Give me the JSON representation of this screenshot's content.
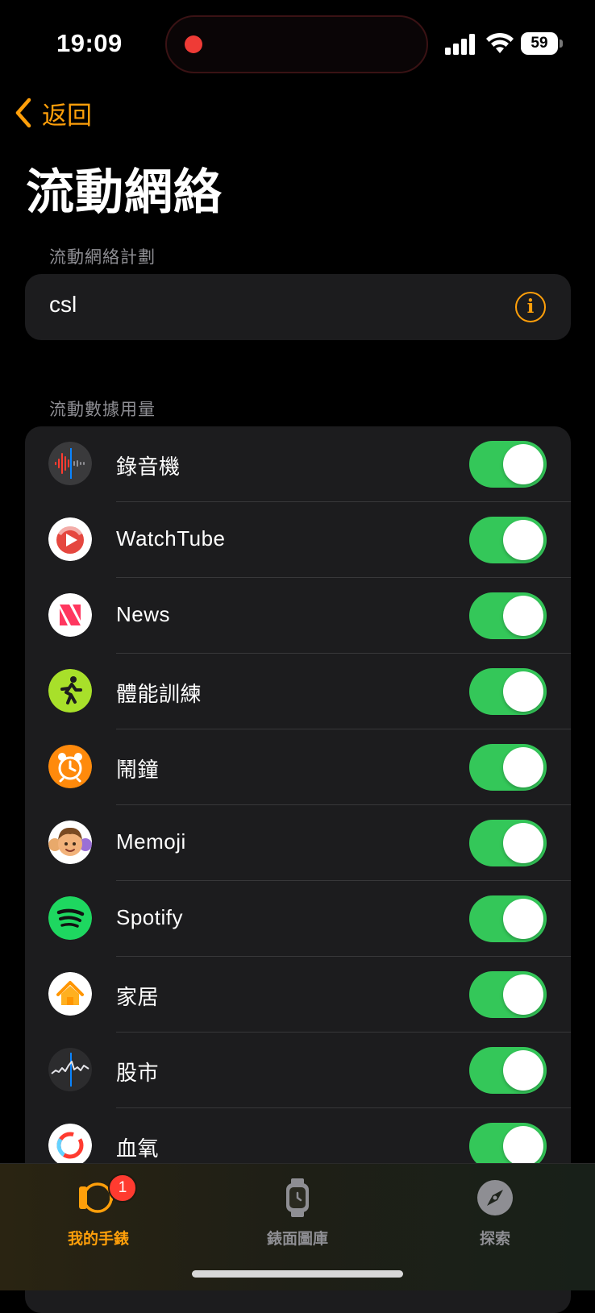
{
  "status_bar": {
    "time": "19:09",
    "battery": "59",
    "recording_color": "#ef3b36"
  },
  "nav": {
    "back_label": "返回"
  },
  "page": {
    "title": "流動網絡"
  },
  "plan_section": {
    "header": "流動網絡計劃",
    "plan_name": "csl"
  },
  "usage_section": {
    "header": "流動數據用量",
    "apps": [
      {
        "name": "錄音機",
        "icon": "voice-memos-icon",
        "enabled": true
      },
      {
        "name": "WatchTube",
        "icon": "watchtube-icon",
        "enabled": true
      },
      {
        "name": "News",
        "icon": "news-icon",
        "enabled": true
      },
      {
        "name": "體能訓練",
        "icon": "workout-icon",
        "enabled": true
      },
      {
        "name": "鬧鐘",
        "icon": "alarm-icon",
        "enabled": true
      },
      {
        "name": "Memoji",
        "icon": "memoji-icon",
        "enabled": true
      },
      {
        "name": "Spotify",
        "icon": "spotify-icon",
        "enabled": true
      },
      {
        "name": "家居",
        "icon": "home-icon",
        "enabled": true
      },
      {
        "name": "股市",
        "icon": "stocks-icon",
        "enabled": true
      },
      {
        "name": "血氧",
        "icon": "blood-oxygen-icon",
        "enabled": true
      }
    ]
  },
  "tab_bar": {
    "tabs": [
      {
        "label": "我的手錶",
        "icon": "watch-icon",
        "active": true,
        "badge": "1"
      },
      {
        "label": "錶面圖庫",
        "icon": "watch-face-icon",
        "active": false
      },
      {
        "label": "探索",
        "icon": "compass-icon",
        "active": false
      }
    ]
  },
  "colors": {
    "accent": "#ff9f0a",
    "toggle_on": "#34c759",
    "card": "#1c1c1e",
    "badge": "#ff3b30"
  }
}
